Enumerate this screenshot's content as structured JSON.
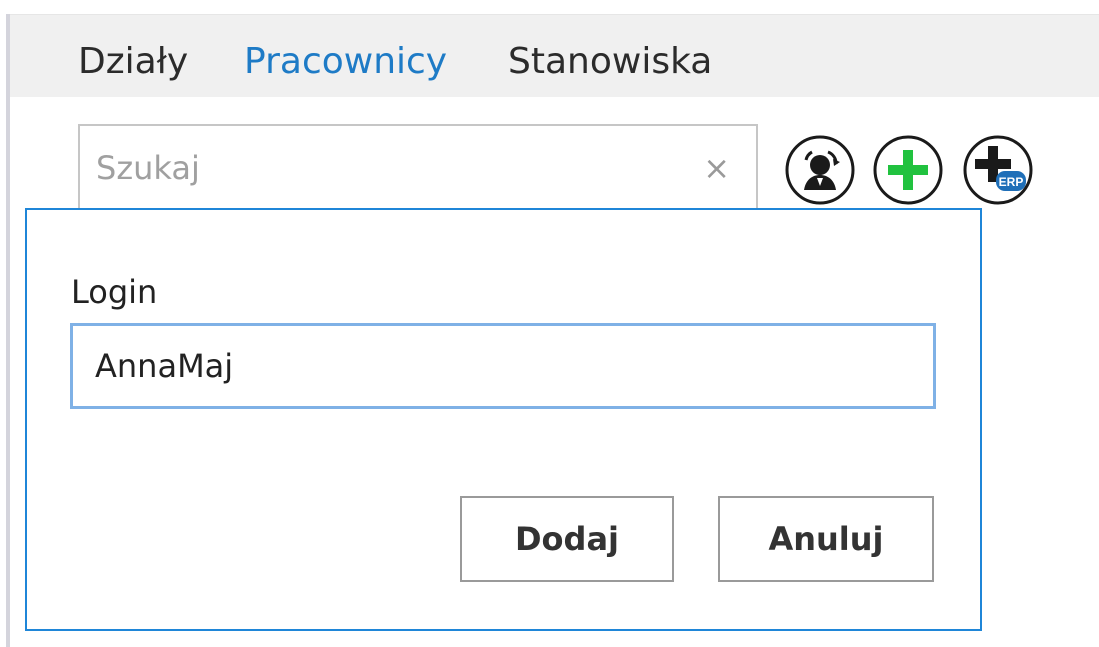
{
  "tabs": [
    {
      "label": "Działy",
      "active": false
    },
    {
      "label": "Pracownicy",
      "active": true
    },
    {
      "label": "Stanowiska",
      "active": false
    }
  ],
  "search": {
    "placeholder": "Szukaj",
    "value": "",
    "clear_glyph": "×"
  },
  "toolbar": {
    "sync_icon": "user-sync-icon",
    "add_icon": "add-icon",
    "add_erp_icon": "add-erp-icon",
    "erp_badge": "ERP"
  },
  "dialog": {
    "field_label": "Login",
    "field_value": "AnnaMaj",
    "confirm_label": "Dodaj",
    "cancel_label": "Anuluj"
  },
  "colors": {
    "accent": "#1e7bc6",
    "dialog_border": "#1f86d8",
    "input_focus_border": "#7fb1e6",
    "add_green": "#21c23f",
    "tab_bar_bg": "#f0f0f0"
  }
}
